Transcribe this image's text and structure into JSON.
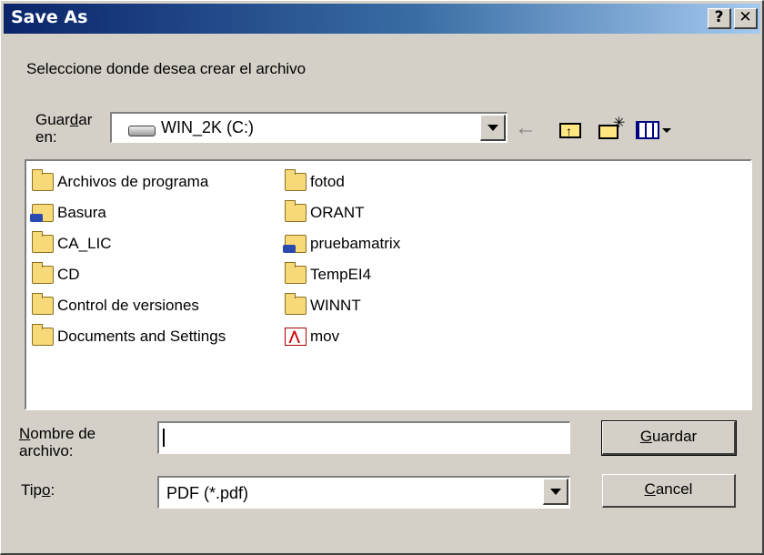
{
  "dialog": {
    "title": "Save As",
    "help_label": "?",
    "close_label": "✕",
    "prompt": "Seleccione donde desea crear el archivo"
  },
  "save_in": {
    "label_pre": "Guar",
    "label_u": "d",
    "label_post": "ar",
    "label_line2": "en:",
    "value": "WIN_2K (C:)",
    "icon": "drive-icon"
  },
  "toolbar": {
    "back_icon": "back-arrow-icon",
    "up_icon": "up-folder-icon",
    "new_folder_icon": "new-folder-icon",
    "view_icon": "view-menu-icon"
  },
  "files": {
    "column1": [
      {
        "name": "Archivos de programa",
        "type": "folder"
      },
      {
        "name": "Basura",
        "type": "shared"
      },
      {
        "name": "CA_LIC",
        "type": "folder"
      },
      {
        "name": "CD",
        "type": "folder"
      },
      {
        "name": "Control de versiones",
        "type": "folder"
      },
      {
        "name": "Documents and Settings",
        "type": "folder"
      }
    ],
    "column2": [
      {
        "name": "fotod",
        "type": "folder"
      },
      {
        "name": "ORANT",
        "type": "folder"
      },
      {
        "name": "pruebamatrix",
        "type": "shared"
      },
      {
        "name": "TempEI4",
        "type": "folder"
      },
      {
        "name": "WINNT",
        "type": "folder"
      },
      {
        "name": "mov",
        "type": "pdf"
      }
    ]
  },
  "filename": {
    "label_u": "N",
    "label_post": "ombre de",
    "label_line2": "archivo:",
    "value": ""
  },
  "filetype": {
    "label_pre": "Tip",
    "label_u": "o",
    "label_post": ":",
    "value": "PDF (*.pdf)"
  },
  "buttons": {
    "save_u": "G",
    "save_post": "uardar",
    "cancel_u": "C",
    "cancel_post": "ancel"
  }
}
